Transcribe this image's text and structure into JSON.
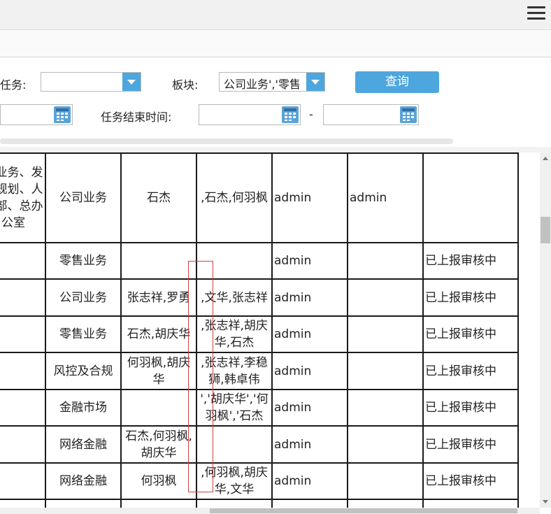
{
  "toolbar": {
    "menu_icon": "hamburger-menu-icon"
  },
  "filters": {
    "task_label": "任务:",
    "task_value": "",
    "sector_label": "板块:",
    "sector_value": "公司业务','零售",
    "query_button": "查询",
    "start_date_value": "",
    "end_time_label": "任务结束时间:",
    "end_time_from": "",
    "range_dash": "-",
    "end_time_to": ""
  },
  "grid": {
    "rows": [
      [
        "司业务、发展规划、人力部、总办公室",
        "公司业务",
        "石杰",
        ",石杰,何羽枫",
        "admin",
        "admin",
        ""
      ],
      [
        "",
        "零售业务",
        "",
        "",
        "admin",
        "",
        "已上报审核中"
      ],
      [
        "",
        "公司业务",
        "张志祥,罗勇",
        ",文华,张志祥",
        "admin",
        "",
        "已上报审核中"
      ],
      [
        "",
        "零售业务",
        "石杰,胡庆华",
        ",张志祥,胡庆华,石杰",
        "admin",
        "",
        "已上报审核中"
      ],
      [
        "",
        "风控及合规",
        "何羽枫,胡庆华",
        ",张志祥,李稳狮,韩卓伟",
        "admin",
        "",
        "已上报审核中"
      ],
      [
        "",
        "金融市场",
        "",
        "','胡庆华','何羽枫','石杰",
        "admin",
        "",
        "已上报审核中"
      ],
      [
        "",
        "网络金融",
        "石杰,何羽枫,胡庆华",
        "",
        "admin",
        "",
        "已上报审核中"
      ],
      [
        "",
        "网络金融",
        "何羽枫",
        ",何羽枫,胡庆华,文华",
        "admin",
        "",
        "已上报审核中"
      ],
      [
        "",
        "",
        "",
        "",
        "",
        "",
        ""
      ]
    ]
  }
}
